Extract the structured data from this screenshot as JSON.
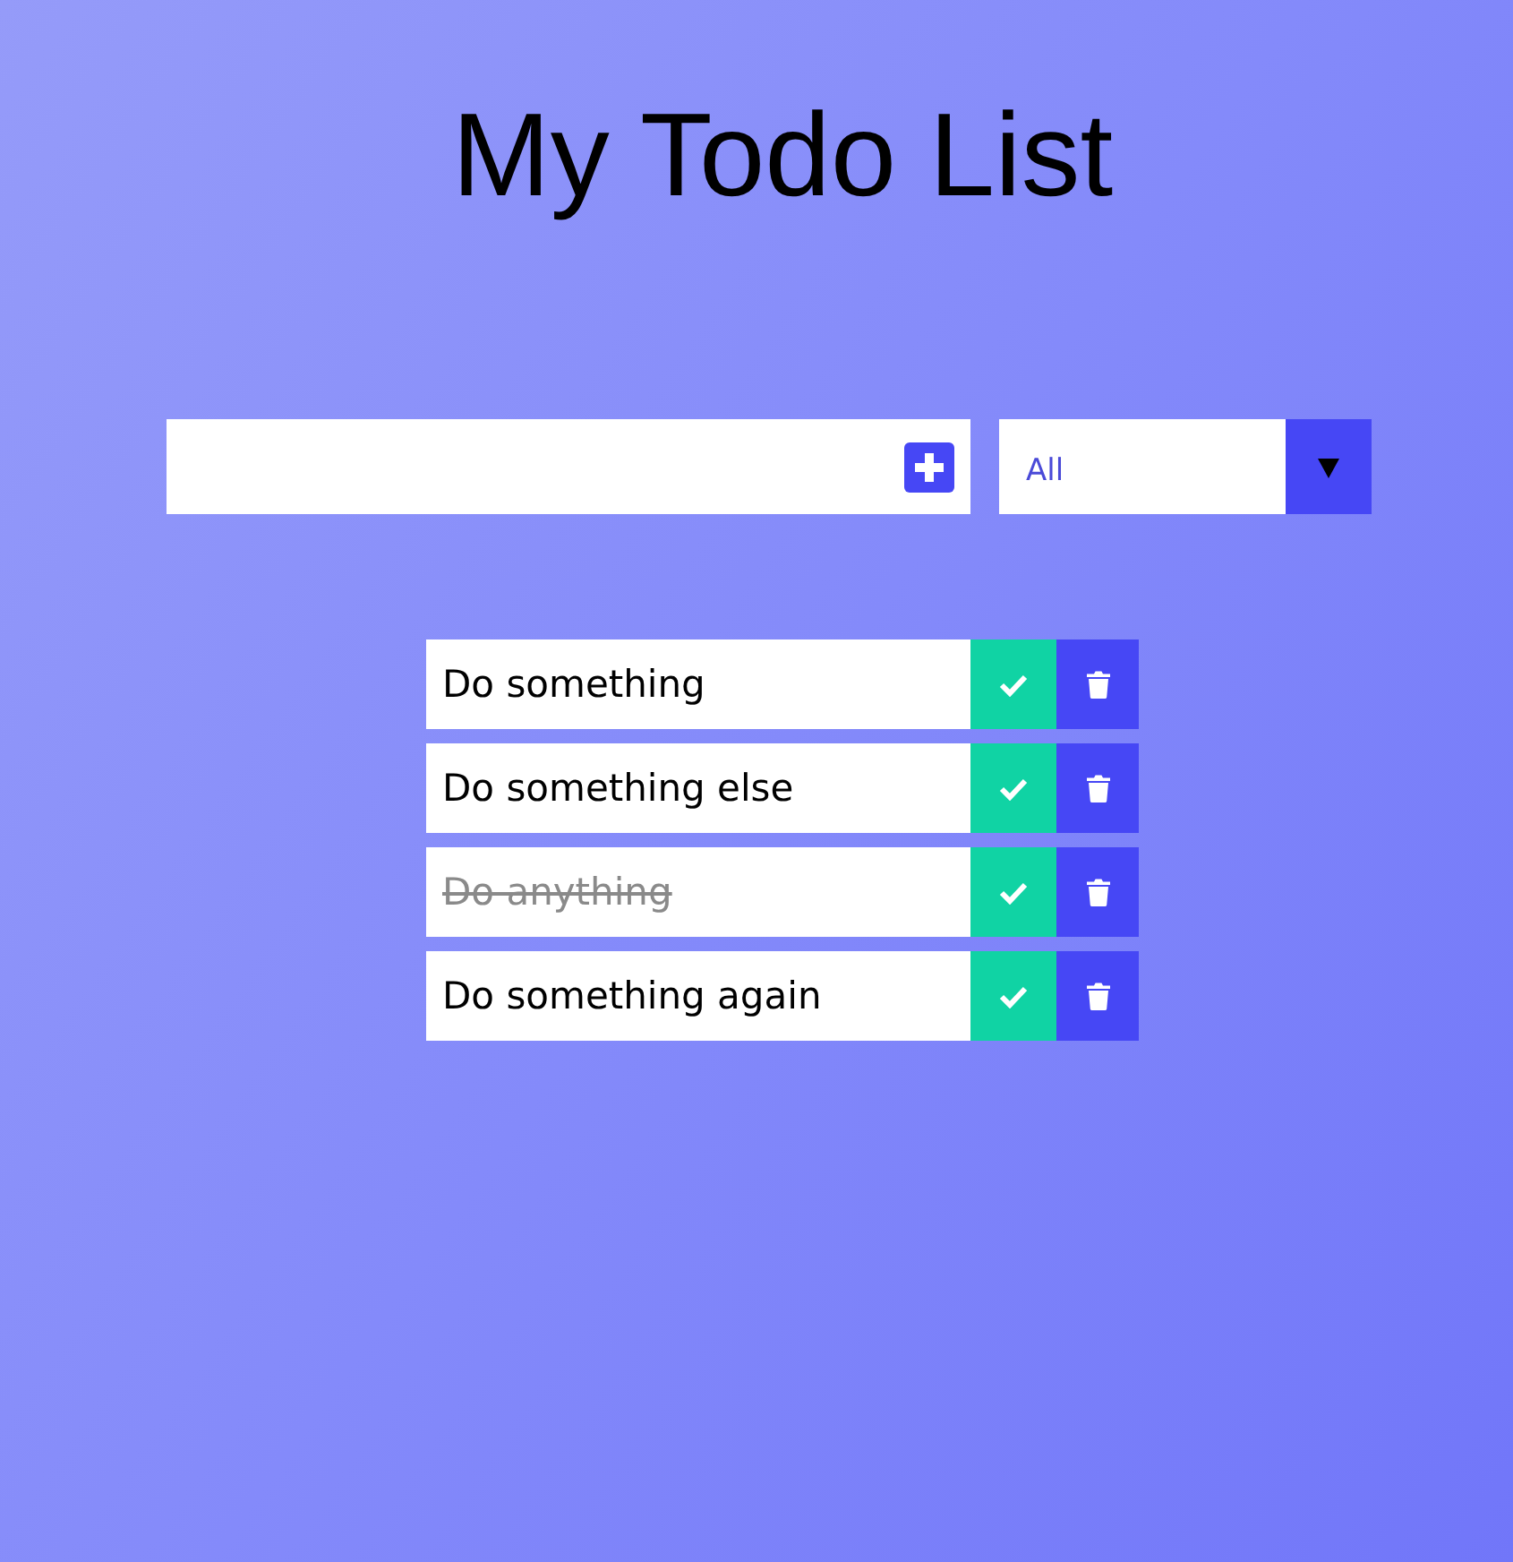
{
  "title": "My Todo List",
  "filter": {
    "value": "All"
  },
  "todos": [
    {
      "text": "Do something",
      "completed": false
    },
    {
      "text": "Do something else",
      "completed": false
    },
    {
      "text": "Do anything",
      "completed": true
    },
    {
      "text": "Do something again",
      "completed": false
    }
  ]
}
